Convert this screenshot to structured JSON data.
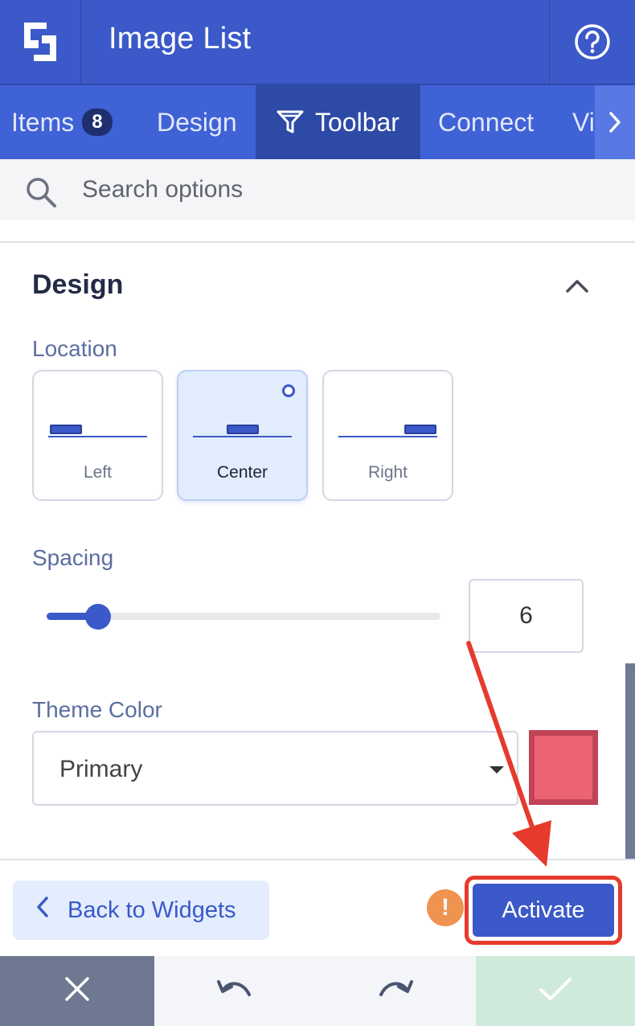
{
  "header": {
    "title": "Image List"
  },
  "tabs": [
    {
      "label": "Items",
      "badge": "8"
    },
    {
      "label": "Design"
    },
    {
      "label": "Toolbar",
      "active": true
    },
    {
      "label": "Connect"
    },
    {
      "label": "Vi"
    }
  ],
  "search": {
    "placeholder": "Search options"
  },
  "design": {
    "title": "Design",
    "location": {
      "label": "Location",
      "options": [
        "Left",
        "Center",
        "Right"
      ],
      "selected": "Center"
    },
    "spacing": {
      "label": "Spacing",
      "value": "6",
      "fraction": 0.13
    },
    "theme_color": {
      "label": "Theme Color",
      "value": "Primary",
      "swatch": "#ec6474"
    }
  },
  "footer": {
    "back_label": "Back to Widgets",
    "warning_glyph": "!",
    "activate_label": "Activate"
  },
  "colors": {
    "accent": "#3b59c8",
    "highlight": "#e63a2c",
    "warning": "#ee9350"
  },
  "icons": {
    "logo": "logo-icon",
    "help": "help-circle-icon",
    "search": "search-icon",
    "filter": "filter-icon",
    "chevron_right": "chevron-right-icon",
    "chevron_up": "chevron-up-icon",
    "chevron_left": "chevron-left-icon",
    "close": "close-icon",
    "undo": "undo-icon",
    "redo": "redo-icon",
    "check": "check-icon"
  }
}
